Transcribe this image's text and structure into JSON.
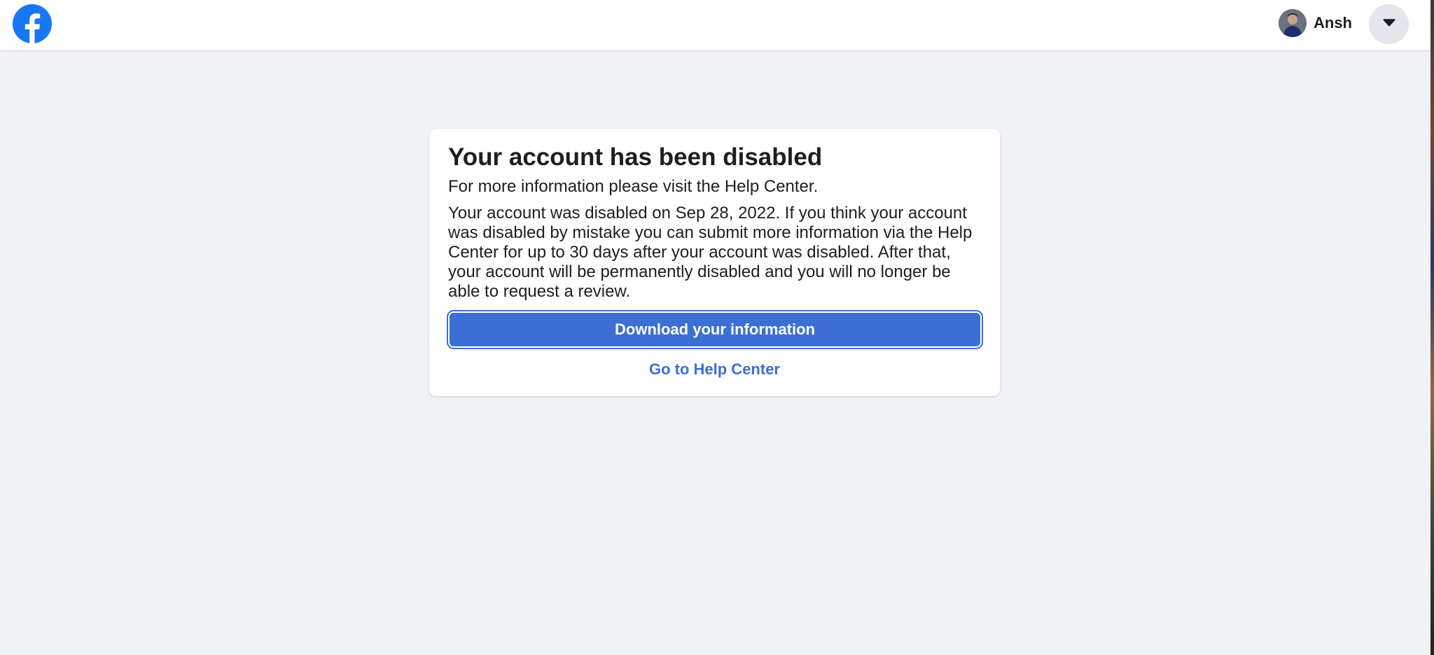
{
  "header": {
    "logo_icon": "facebook-logo-icon",
    "brand_color": "#1877f2",
    "user": {
      "name": "Ansh",
      "avatar_icon": "user-avatar"
    },
    "menu_icon": "caret-down-icon"
  },
  "card": {
    "title": "Your account has been disabled",
    "subtitle": "For more information please visit the Help Center.",
    "body": "Your account was disabled on Sep 28, 2022. If you think your account was disabled by mistake you can submit more information via the Help Center for up to 30 days after your account was disabled. After that, your account will be permanently disabled and you will no longer be able to request a review.",
    "primary_button_label": "Download your information",
    "help_link_label": "Go to Help Center"
  },
  "colors": {
    "page_background": "#f0f2f5",
    "accent": "#3b6fd4",
    "text": "#1c1e21"
  }
}
